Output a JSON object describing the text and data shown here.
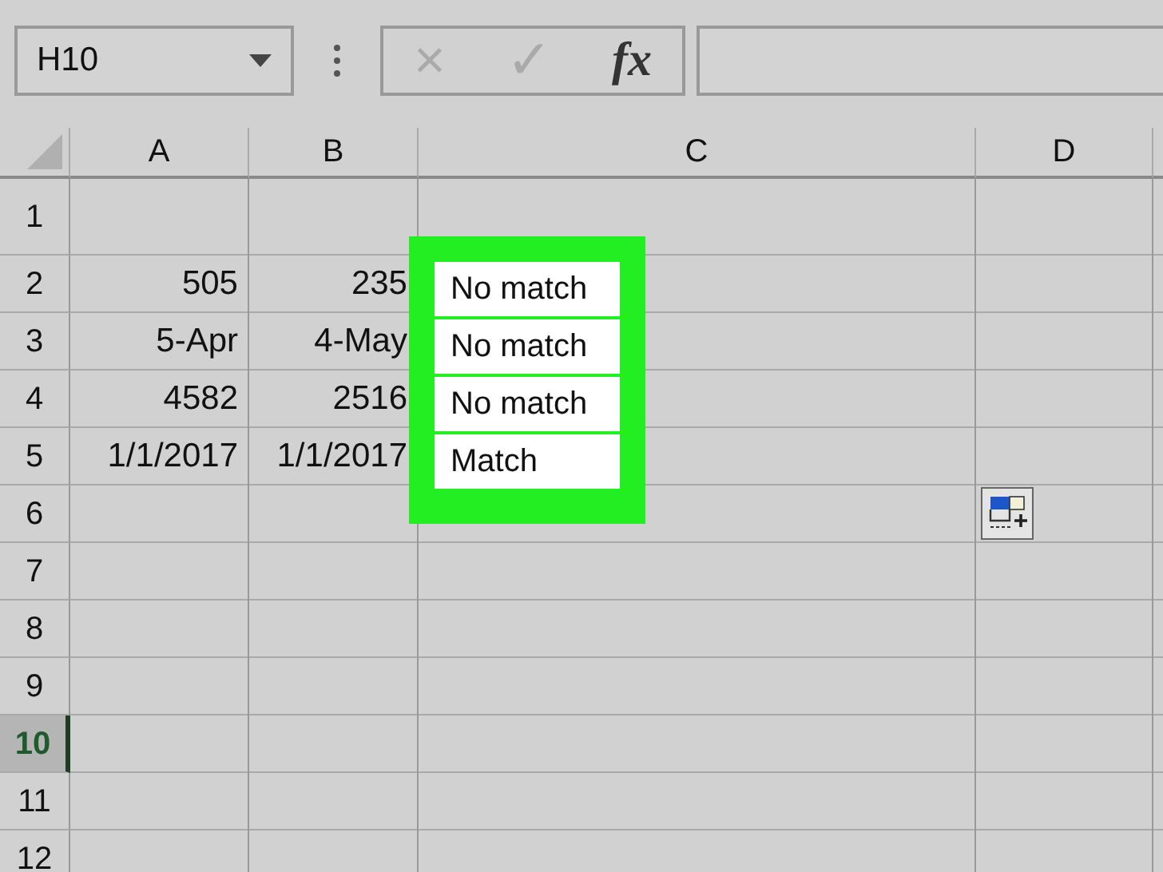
{
  "name_box": {
    "value": "H10"
  },
  "formula_bar": {
    "cancel": "×",
    "enter": "✓",
    "function": "fx"
  },
  "columns": [
    "A",
    "B",
    "C",
    "D"
  ],
  "rows": [
    {
      "label": "1",
      "selected": false,
      "cells": [
        "",
        "",
        ""
      ]
    },
    {
      "label": "2",
      "selected": false,
      "cells": [
        "505",
        "235",
        "No match"
      ]
    },
    {
      "label": "3",
      "selected": false,
      "cells": [
        "5-Apr",
        "4-May",
        "No match"
      ]
    },
    {
      "label": "4",
      "selected": false,
      "cells": [
        "4582",
        "2516",
        "No match"
      ]
    },
    {
      "label": "5",
      "selected": false,
      "cells": [
        "1/1/2017",
        "1/1/2017",
        "Match"
      ]
    },
    {
      "label": "6",
      "selected": false,
      "cells": [
        "",
        "",
        ""
      ]
    },
    {
      "label": "7",
      "selected": false,
      "cells": [
        "",
        "",
        ""
      ]
    },
    {
      "label": "8",
      "selected": false,
      "cells": [
        "",
        "",
        ""
      ]
    },
    {
      "label": "9",
      "selected": false,
      "cells": [
        "",
        "",
        ""
      ]
    },
    {
      "label": "10",
      "selected": true,
      "cells": [
        "",
        "",
        ""
      ]
    },
    {
      "label": "11",
      "selected": false,
      "cells": [
        "",
        "",
        ""
      ]
    },
    {
      "label": "12",
      "selected": false,
      "cells": [
        "",
        "",
        ""
      ]
    }
  ],
  "highlight": {
    "color": "#22ee22"
  }
}
